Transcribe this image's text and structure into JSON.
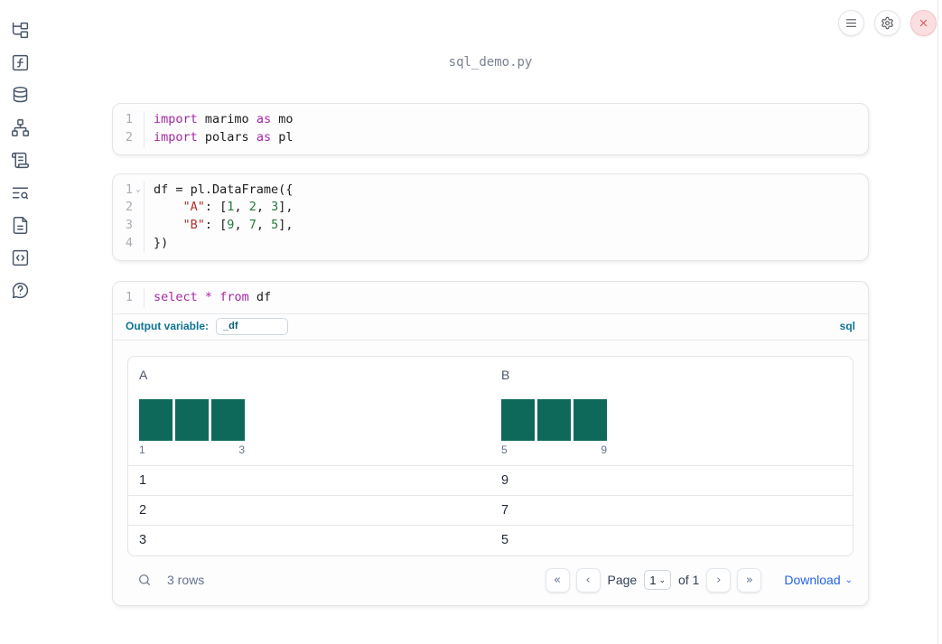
{
  "app": {
    "title": "sql_demo.py"
  },
  "topbar": {
    "buttons": [
      {
        "name": "menu"
      },
      {
        "name": "settings"
      },
      {
        "name": "close"
      }
    ]
  },
  "sidebar": {
    "items": [
      {
        "icon": "file-tree"
      },
      {
        "icon": "function-square"
      },
      {
        "icon": "database"
      },
      {
        "icon": "dependency-graph"
      },
      {
        "icon": "scroll"
      },
      {
        "icon": "text-search"
      },
      {
        "icon": "document"
      },
      {
        "icon": "snippets"
      },
      {
        "icon": "help-bubble"
      }
    ]
  },
  "cells": [
    {
      "name": "imports-cell",
      "lines": [
        {
          "num": "1",
          "tokens": [
            [
              "kw",
              "import"
            ],
            [
              "pl",
              " marimo "
            ],
            [
              "kw",
              "as"
            ],
            [
              "pl",
              " mo"
            ]
          ]
        },
        {
          "num": "2",
          "tokens": [
            [
              "kw",
              "import"
            ],
            [
              "pl",
              " polars "
            ],
            [
              "kw",
              "as"
            ],
            [
              "pl",
              " pl"
            ]
          ]
        }
      ]
    },
    {
      "name": "dataframe-cell",
      "lines": [
        {
          "num": "1",
          "fold": "⌄",
          "tokens": [
            [
              "pl",
              "df = pl.DataFrame({"
            ]
          ]
        },
        {
          "num": "2",
          "tokens": [
            [
              "pl",
              "    "
            ],
            [
              "str",
              "\"A\""
            ],
            [
              "pl",
              ": ["
            ],
            [
              "num",
              "1"
            ],
            [
              "pl",
              ", "
            ],
            [
              "num",
              "2"
            ],
            [
              "pl",
              ", "
            ],
            [
              "num",
              "3"
            ],
            [
              "pl",
              "],"
            ]
          ]
        },
        {
          "num": "3",
          "tokens": [
            [
              "pl",
              "    "
            ],
            [
              "str",
              "\"B\""
            ],
            [
              "pl",
              ": ["
            ],
            [
              "num",
              "9"
            ],
            [
              "pl",
              ", "
            ],
            [
              "num",
              "7"
            ],
            [
              "pl",
              ", "
            ],
            [
              "num",
              "5"
            ],
            [
              "pl",
              "],"
            ]
          ]
        },
        {
          "num": "4",
          "tokens": [
            [
              "pl",
              "})"
            ]
          ]
        }
      ]
    },
    {
      "name": "sql-cell",
      "lines": [
        {
          "num": "1",
          "tokens": [
            [
              "kw",
              "select"
            ],
            [
              "pl",
              " "
            ],
            [
              "kw",
              "*"
            ],
            [
              "pl",
              " "
            ],
            [
              "kw",
              "from"
            ],
            [
              "pl",
              " df"
            ]
          ]
        }
      ]
    }
  ],
  "sql_cell": {
    "output_variable_label": "Output variable:",
    "output_variable_value": "_df",
    "language_badge": "sql"
  },
  "table": {
    "columns": [
      {
        "name": "A",
        "hist": {
          "bar_count": 3,
          "bar_color": "#0e695a",
          "min_label": "1",
          "max_label": "3"
        }
      },
      {
        "name": "B",
        "hist": {
          "bar_count": 3,
          "bar_color": "#0e695a",
          "min_label": "5",
          "max_label": "9"
        }
      }
    ],
    "rows": [
      [
        "1",
        "9"
      ],
      [
        "2",
        "7"
      ],
      [
        "3",
        "5"
      ]
    ],
    "footer": {
      "rows_count": "3 rows",
      "pagination": {
        "first_icon": "«",
        "prev_icon": "‹",
        "page_label": "Page",
        "page_value": "1",
        "select_caret": "⌄",
        "of_label": "of 1",
        "next_icon": "›",
        "last_icon": "»"
      },
      "download_label": "Download",
      "download_caret": "⌄"
    }
  },
  "colors": {
    "accent_blue": "#2563eb",
    "teal_label": "#0e7490",
    "histogram_bar": "#0e695a",
    "keyword": "#a626a4",
    "string": "#b0302c",
    "number": "#217a3c"
  }
}
